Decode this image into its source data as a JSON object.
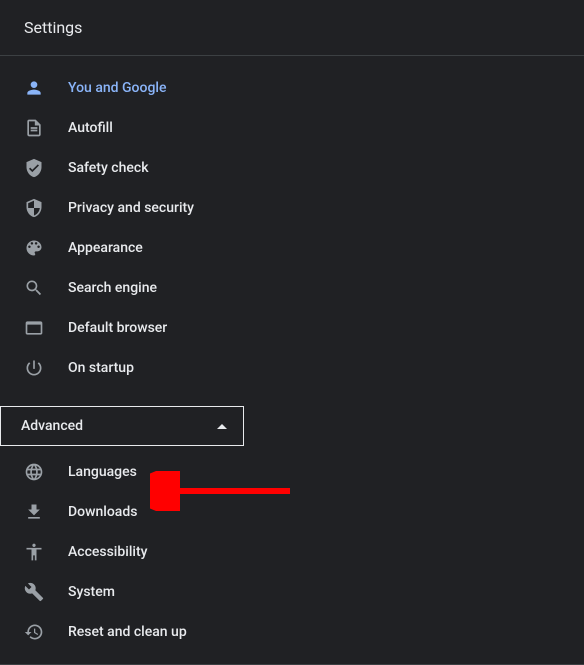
{
  "header": {
    "title": "Settings"
  },
  "nav": {
    "items": [
      {
        "label": "You and Google"
      },
      {
        "label": "Autofill"
      },
      {
        "label": "Safety check"
      },
      {
        "label": "Privacy and security"
      },
      {
        "label": "Appearance"
      },
      {
        "label": "Search engine"
      },
      {
        "label": "Default browser"
      },
      {
        "label": "On startup"
      }
    ]
  },
  "advanced": {
    "label": "Advanced",
    "items": [
      {
        "label": "Languages"
      },
      {
        "label": "Downloads"
      },
      {
        "label": "Accessibility"
      },
      {
        "label": "System"
      },
      {
        "label": "Reset and clean up"
      }
    ]
  }
}
